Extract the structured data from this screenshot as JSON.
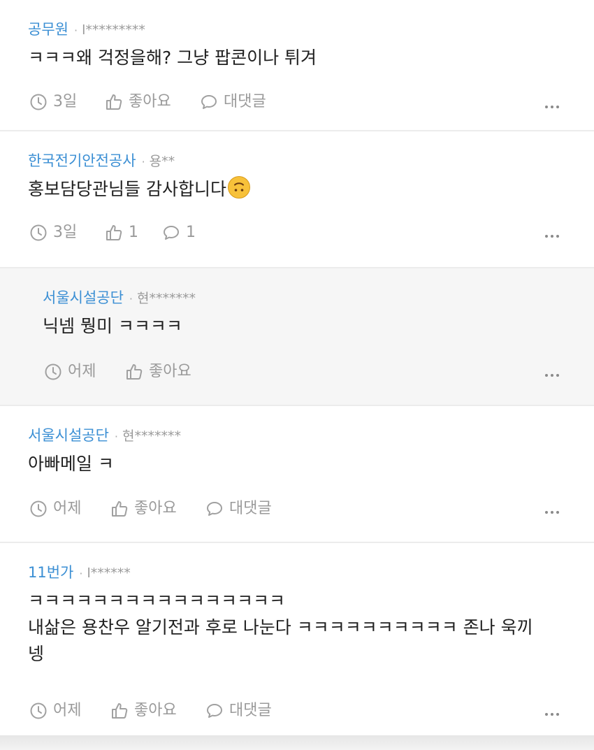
{
  "comments": [
    {
      "org": "공무원",
      "sep": "·",
      "user": "l*********",
      "lines": [
        "ㅋㅋㅋ왜 걱정을해? 그냥 팝콘이나 튀겨"
      ],
      "time": "3일",
      "like": "좋아요",
      "reply": "대댓글"
    },
    {
      "org": "한국전기안전공사",
      "sep": "·",
      "user": "용**",
      "lines": [
        "홍보담당관님들 감사합니다"
      ],
      "emoji": "upside-down-face",
      "time": "3일",
      "like": "1",
      "reply": "1"
    },
    {
      "org": "서울시설공단",
      "sep": "·",
      "user": "현*******",
      "lines": [
        "닉넴 뭥미 ㅋㅋㅋㅋ"
      ],
      "time": "어제",
      "like": "좋아요",
      "is_reply": true
    },
    {
      "org": "서울시설공단",
      "sep": "·",
      "user": "현*******",
      "lines": [
        "아빠메일 ㅋ"
      ],
      "time": "어제",
      "like": "좋아요",
      "reply": "대댓글"
    },
    {
      "org": "11번가",
      "sep": "·",
      "user": "l******",
      "lines": [
        "ㅋㅋㅋㅋㅋㅋㅋㅋㅋㅋㅋㅋㅋㅋㅋㅋ",
        "내삶은 용찬우 알기전과 후로 나눈다 ㅋㅋㅋㅋㅋㅋㅋㅋㅋㅋ 존나 욱끼",
        "넹"
      ],
      "time": "어제",
      "like": "좋아요",
      "reply": "대댓글"
    }
  ],
  "colors": {
    "org": "#3b8fd4",
    "meta": "#9a9a9a",
    "reply_bg": "#f6f6f6"
  },
  "icons": {
    "time": "clock-icon",
    "like": "thumbs-up-icon",
    "reply": "speech-bubble-icon",
    "more": "more-dots-icon"
  }
}
